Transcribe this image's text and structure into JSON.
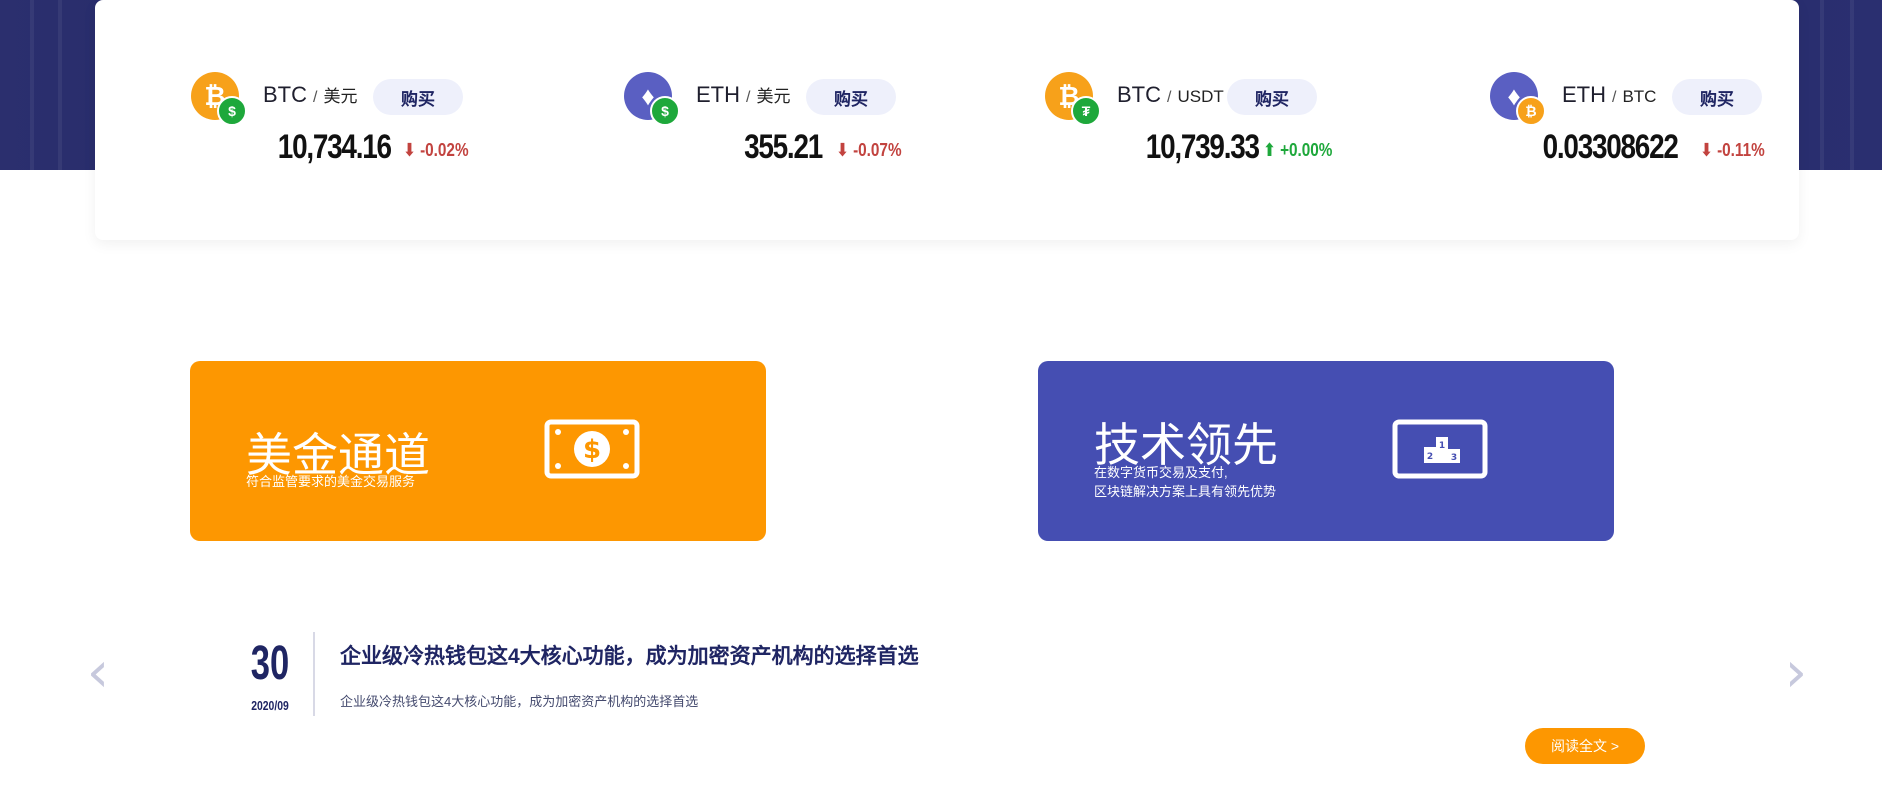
{
  "tickers": [
    {
      "coin": "BTC",
      "coin_symbol": "₿",
      "badge_symbol": "$",
      "base": "BTC",
      "quote": "美元",
      "buy_label": "购买",
      "price": "10,734.16",
      "change": "⬇ -0.02%",
      "direction": "down"
    },
    {
      "coin": "ETH",
      "coin_symbol": "♦",
      "badge_symbol": "$",
      "base": "ETH",
      "quote": "美元",
      "buy_label": "购买",
      "price": "355.21",
      "change": "⬇ -0.07%",
      "direction": "down"
    },
    {
      "coin": "BTC",
      "coin_symbol": "₿",
      "badge_symbol": "₮",
      "base": "BTC",
      "quote": "USDT",
      "buy_label": "购买",
      "price": "10,739.33",
      "change": "⬆ +0.00%",
      "direction": "up"
    },
    {
      "coin": "ETH",
      "coin_symbol": "♦",
      "badge_symbol": "₿",
      "base": "ETH",
      "quote": "BTC",
      "buy_label": "购买",
      "price": "0.03308622",
      "change": "⬇ -0.11%",
      "direction": "down"
    }
  ],
  "pair_separator": "/",
  "features": [
    {
      "title": "美金通道",
      "desc_line1": "符合监管要求的美金交易服务",
      "desc_line2": "",
      "icon": "dollar-bill-icon"
    },
    {
      "title": "技术领先",
      "desc_line1": "在数字货币交易及支付,",
      "desc_line2": "区块链解决方案上具有领先优势",
      "icon": "podium-icon"
    }
  ],
  "news": {
    "day": "30",
    "month": "2020/09",
    "title": "企业级冷热钱包这4大核心功能，成为加密资产机构的选择首选",
    "summary": "企业级冷热钱包这4大核心功能，成为加密资产机构的选择首选",
    "read_more": "阅读全文 >",
    "prev_arrow": "‹",
    "next_arrow": "›"
  },
  "colors": {
    "banner": "#1f2563",
    "orange": "#fd9701",
    "purple": "#454eb2",
    "down": "#c2433f",
    "up": "#1ea83b",
    "btc": "#f7a11a",
    "eth": "#5a5fc2"
  }
}
